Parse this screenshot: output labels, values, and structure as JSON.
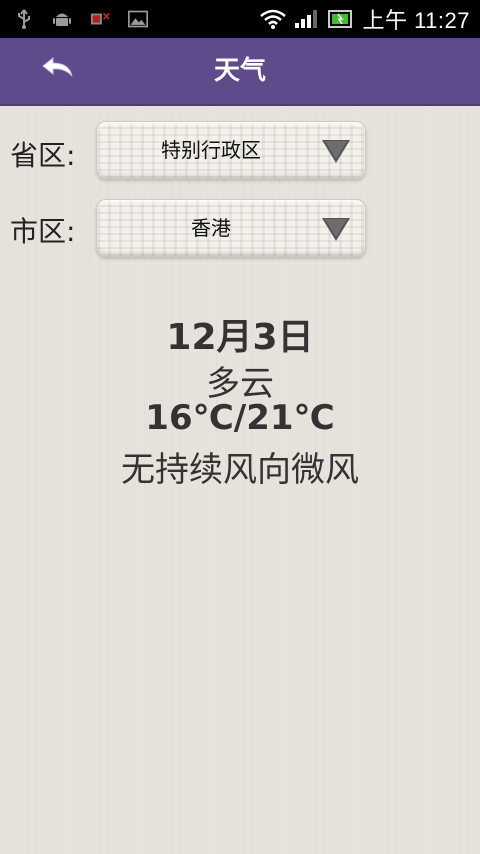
{
  "status_bar": {
    "time": "上午 11:27",
    "icons_left": [
      "usb-icon",
      "android-icon",
      "sim-error-icon",
      "image-icon"
    ],
    "icons_right": [
      "wifi-icon",
      "signal-icon",
      "battery-icon"
    ]
  },
  "header": {
    "title": "天气"
  },
  "province": {
    "label": "省区:",
    "selected": "特别行政区"
  },
  "city": {
    "label": "市区:",
    "selected": "香港"
  },
  "weather": {
    "date": "12月3日",
    "condition": "多云",
    "temperature": "16℃/21℃",
    "wind": "无持续风向微风"
  },
  "colors": {
    "header_bg": "#5f4a8b",
    "page_bg": "#e7e3dc",
    "battery_green": "#3fbf2f"
  }
}
